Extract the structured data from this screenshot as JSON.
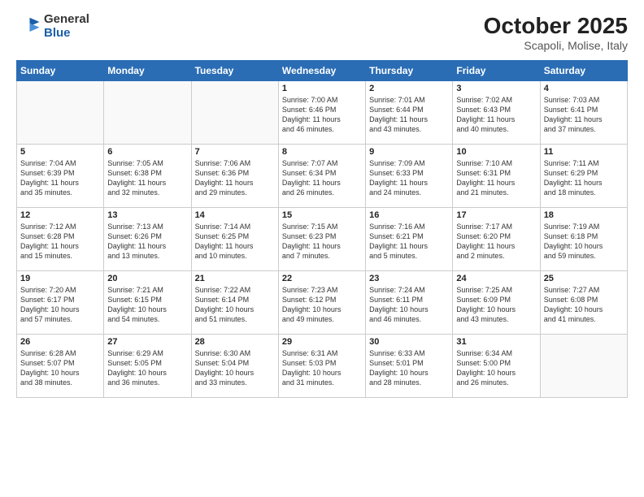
{
  "header": {
    "logo_general": "General",
    "logo_blue": "Blue",
    "month_title": "October 2025",
    "location": "Scapoli, Molise, Italy"
  },
  "weekdays": [
    "Sunday",
    "Monday",
    "Tuesday",
    "Wednesday",
    "Thursday",
    "Friday",
    "Saturday"
  ],
  "weeks": [
    [
      {
        "day": "",
        "info": ""
      },
      {
        "day": "",
        "info": ""
      },
      {
        "day": "",
        "info": ""
      },
      {
        "day": "1",
        "info": "Sunrise: 7:00 AM\nSunset: 6:46 PM\nDaylight: 11 hours\nand 46 minutes."
      },
      {
        "day": "2",
        "info": "Sunrise: 7:01 AM\nSunset: 6:44 PM\nDaylight: 11 hours\nand 43 minutes."
      },
      {
        "day": "3",
        "info": "Sunrise: 7:02 AM\nSunset: 6:43 PM\nDaylight: 11 hours\nand 40 minutes."
      },
      {
        "day": "4",
        "info": "Sunrise: 7:03 AM\nSunset: 6:41 PM\nDaylight: 11 hours\nand 37 minutes."
      }
    ],
    [
      {
        "day": "5",
        "info": "Sunrise: 7:04 AM\nSunset: 6:39 PM\nDaylight: 11 hours\nand 35 minutes."
      },
      {
        "day": "6",
        "info": "Sunrise: 7:05 AM\nSunset: 6:38 PM\nDaylight: 11 hours\nand 32 minutes."
      },
      {
        "day": "7",
        "info": "Sunrise: 7:06 AM\nSunset: 6:36 PM\nDaylight: 11 hours\nand 29 minutes."
      },
      {
        "day": "8",
        "info": "Sunrise: 7:07 AM\nSunset: 6:34 PM\nDaylight: 11 hours\nand 26 minutes."
      },
      {
        "day": "9",
        "info": "Sunrise: 7:09 AM\nSunset: 6:33 PM\nDaylight: 11 hours\nand 24 minutes."
      },
      {
        "day": "10",
        "info": "Sunrise: 7:10 AM\nSunset: 6:31 PM\nDaylight: 11 hours\nand 21 minutes."
      },
      {
        "day": "11",
        "info": "Sunrise: 7:11 AM\nSunset: 6:29 PM\nDaylight: 11 hours\nand 18 minutes."
      }
    ],
    [
      {
        "day": "12",
        "info": "Sunrise: 7:12 AM\nSunset: 6:28 PM\nDaylight: 11 hours\nand 15 minutes."
      },
      {
        "day": "13",
        "info": "Sunrise: 7:13 AM\nSunset: 6:26 PM\nDaylight: 11 hours\nand 13 minutes."
      },
      {
        "day": "14",
        "info": "Sunrise: 7:14 AM\nSunset: 6:25 PM\nDaylight: 11 hours\nand 10 minutes."
      },
      {
        "day": "15",
        "info": "Sunrise: 7:15 AM\nSunset: 6:23 PM\nDaylight: 11 hours\nand 7 minutes."
      },
      {
        "day": "16",
        "info": "Sunrise: 7:16 AM\nSunset: 6:21 PM\nDaylight: 11 hours\nand 5 minutes."
      },
      {
        "day": "17",
        "info": "Sunrise: 7:17 AM\nSunset: 6:20 PM\nDaylight: 11 hours\nand 2 minutes."
      },
      {
        "day": "18",
        "info": "Sunrise: 7:19 AM\nSunset: 6:18 PM\nDaylight: 10 hours\nand 59 minutes."
      }
    ],
    [
      {
        "day": "19",
        "info": "Sunrise: 7:20 AM\nSunset: 6:17 PM\nDaylight: 10 hours\nand 57 minutes."
      },
      {
        "day": "20",
        "info": "Sunrise: 7:21 AM\nSunset: 6:15 PM\nDaylight: 10 hours\nand 54 minutes."
      },
      {
        "day": "21",
        "info": "Sunrise: 7:22 AM\nSunset: 6:14 PM\nDaylight: 10 hours\nand 51 minutes."
      },
      {
        "day": "22",
        "info": "Sunrise: 7:23 AM\nSunset: 6:12 PM\nDaylight: 10 hours\nand 49 minutes."
      },
      {
        "day": "23",
        "info": "Sunrise: 7:24 AM\nSunset: 6:11 PM\nDaylight: 10 hours\nand 46 minutes."
      },
      {
        "day": "24",
        "info": "Sunrise: 7:25 AM\nSunset: 6:09 PM\nDaylight: 10 hours\nand 43 minutes."
      },
      {
        "day": "25",
        "info": "Sunrise: 7:27 AM\nSunset: 6:08 PM\nDaylight: 10 hours\nand 41 minutes."
      }
    ],
    [
      {
        "day": "26",
        "info": "Sunrise: 6:28 AM\nSunset: 5:07 PM\nDaylight: 10 hours\nand 38 minutes."
      },
      {
        "day": "27",
        "info": "Sunrise: 6:29 AM\nSunset: 5:05 PM\nDaylight: 10 hours\nand 36 minutes."
      },
      {
        "day": "28",
        "info": "Sunrise: 6:30 AM\nSunset: 5:04 PM\nDaylight: 10 hours\nand 33 minutes."
      },
      {
        "day": "29",
        "info": "Sunrise: 6:31 AM\nSunset: 5:03 PM\nDaylight: 10 hours\nand 31 minutes."
      },
      {
        "day": "30",
        "info": "Sunrise: 6:33 AM\nSunset: 5:01 PM\nDaylight: 10 hours\nand 28 minutes."
      },
      {
        "day": "31",
        "info": "Sunrise: 6:34 AM\nSunset: 5:00 PM\nDaylight: 10 hours\nand 26 minutes."
      },
      {
        "day": "",
        "info": ""
      }
    ]
  ]
}
